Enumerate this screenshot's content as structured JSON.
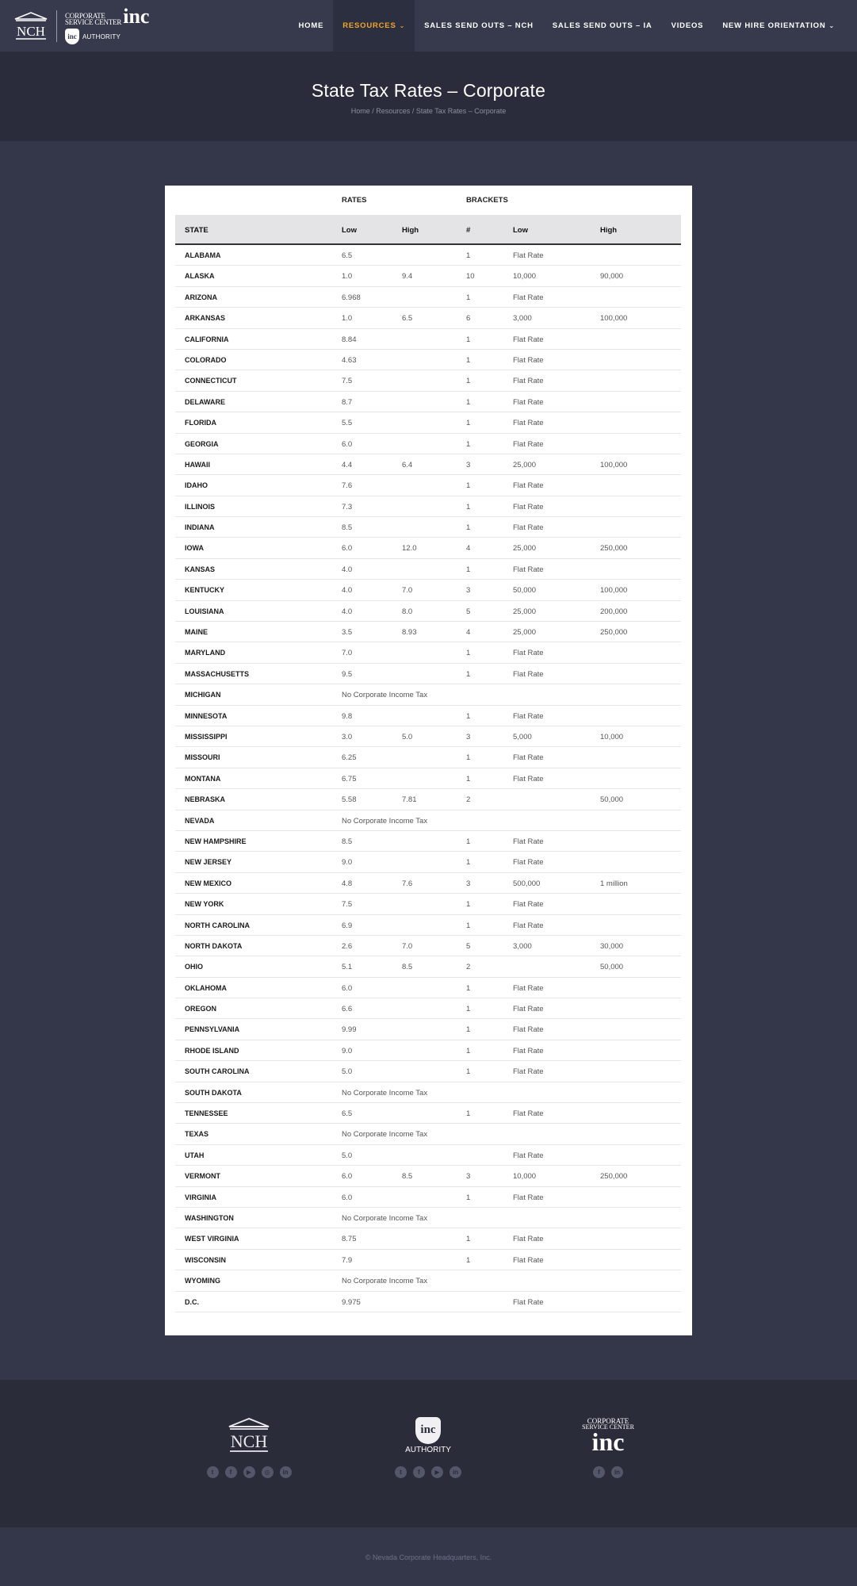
{
  "brand": {
    "nch": "NCH",
    "csc_line1": "CORPORATE",
    "csc_line2": "SERVICE CENTER",
    "csc_inc": "inc",
    "badge": "inc",
    "authority": "AUTHORITY"
  },
  "nav": [
    {
      "label": "HOME",
      "active": false,
      "dropdown": false
    },
    {
      "label": "RESOURCES",
      "active": true,
      "dropdown": true
    },
    {
      "label": "SALES SEND OUTS – NCH",
      "active": false,
      "dropdown": false
    },
    {
      "label": "SALES SEND OUTS – IA",
      "active": false,
      "dropdown": false
    },
    {
      "label": "VIDEOS",
      "active": false,
      "dropdown": false
    },
    {
      "label": "NEW HIRE ORIENTATION",
      "active": false,
      "dropdown": true
    }
  ],
  "page": {
    "title": "State Tax Rates – Corporate",
    "breadcrumb": {
      "home": "Home",
      "sep": "/",
      "resources": "Resources",
      "current": "State Tax Rates – Corporate"
    }
  },
  "table": {
    "group_headers": {
      "rates": "RATES",
      "brackets": "BRACKETS"
    },
    "columns": [
      "STATE",
      "Low",
      "High",
      "#",
      "Low",
      "High"
    ],
    "rows": [
      {
        "state": "ALABAMA",
        "low": "6.5",
        "high": "",
        "num": "1",
        "blow": "Flat Rate",
        "bhigh": ""
      },
      {
        "state": "ALASKA",
        "low": "1.0",
        "high": "9.4",
        "num": "10",
        "blow": "10,000",
        "bhigh": "90,000"
      },
      {
        "state": "ARIZONA",
        "low": "6.968",
        "high": "",
        "num": "1",
        "blow": "Flat Rate",
        "bhigh": ""
      },
      {
        "state": "ARKANSAS",
        "low": "1.0",
        "high": "6.5",
        "num": "6",
        "blow": "3,000",
        "bhigh": "100,000"
      },
      {
        "state": "CALIFORNIA",
        "low": "8.84",
        "high": "",
        "num": "1",
        "blow": "Flat Rate",
        "bhigh": ""
      },
      {
        "state": "COLORADO",
        "low": "4.63",
        "high": "",
        "num": "1",
        "blow": "Flat Rate",
        "bhigh": ""
      },
      {
        "state": "CONNECTICUT",
        "low": "7.5",
        "high": "",
        "num": "1",
        "blow": "Flat Rate",
        "bhigh": ""
      },
      {
        "state": "DELAWARE",
        "low": "8.7",
        "high": "",
        "num": "1",
        "blow": "Flat Rate",
        "bhigh": ""
      },
      {
        "state": "FLORIDA",
        "low": "5.5",
        "high": "",
        "num": "1",
        "blow": "Flat Rate",
        "bhigh": ""
      },
      {
        "state": "GEORGIA",
        "low": "6.0",
        "high": "",
        "num": "1",
        "blow": "Flat Rate",
        "bhigh": ""
      },
      {
        "state": "HAWAII",
        "low": "4.4",
        "high": "6.4",
        "num": "3",
        "blow": "25,000",
        "bhigh": "100,000"
      },
      {
        "state": "IDAHO",
        "low": "7.6",
        "high": "",
        "num": "1",
        "blow": "Flat Rate",
        "bhigh": ""
      },
      {
        "state": "ILLINOIS",
        "low": "7.3",
        "high": "",
        "num": "1",
        "blow": "Flat Rate",
        "bhigh": ""
      },
      {
        "state": "INDIANA",
        "low": "8.5",
        "high": "",
        "num": "1",
        "blow": "Flat Rate",
        "bhigh": ""
      },
      {
        "state": "IOWA",
        "low": "6.0",
        "high": "12.0",
        "num": "4",
        "blow": "25,000",
        "bhigh": "250,000"
      },
      {
        "state": "KANSAS",
        "low": "4.0",
        "high": "",
        "num": "1",
        "blow": "Flat Rate",
        "bhigh": ""
      },
      {
        "state": "KENTUCKY",
        "low": "4.0",
        "high": "7.0",
        "num": "3",
        "blow": "50,000",
        "bhigh": "100,000"
      },
      {
        "state": "LOUISIANA",
        "low": "4.0",
        "high": "8.0",
        "num": "5",
        "blow": "25,000",
        "bhigh": "200,000"
      },
      {
        "state": "MAINE",
        "low": "3.5",
        "high": "8.93",
        "num": "4",
        "blow": "25,000",
        "bhigh": "250,000"
      },
      {
        "state": "MARYLAND",
        "low": "7.0",
        "high": "",
        "num": "1",
        "blow": "Flat Rate",
        "bhigh": ""
      },
      {
        "state": "MASSACHUSETTS",
        "low": "9.5",
        "high": "",
        "num": "1",
        "blow": "Flat Rate",
        "bhigh": ""
      },
      {
        "state": "MICHIGAN",
        "low": "No Corporate Income Tax",
        "high": "",
        "num": "",
        "blow": "",
        "bhigh": ""
      },
      {
        "state": "MINNESOTA",
        "low": "9.8",
        "high": "",
        "num": "1",
        "blow": "Flat Rate",
        "bhigh": ""
      },
      {
        "state": "MISSISSIPPI",
        "low": "3.0",
        "high": "5.0",
        "num": "3",
        "blow": "5,000",
        "bhigh": "10,000"
      },
      {
        "state": "MISSOURI",
        "low": "6.25",
        "high": "",
        "num": "1",
        "blow": "Flat Rate",
        "bhigh": ""
      },
      {
        "state": "MONTANA",
        "low": "6.75",
        "high": "",
        "num": "1",
        "blow": "Flat Rate",
        "bhigh": ""
      },
      {
        "state": "NEBRASKA",
        "low": "5.58",
        "high": "7.81",
        "num": "2",
        "blow": "",
        "bhigh": "50,000"
      },
      {
        "state": "NEVADA",
        "low": "No Corporate Income Tax",
        "high": "",
        "num": "",
        "blow": "",
        "bhigh": ""
      },
      {
        "state": "NEW HAMPSHIRE",
        "low": "8.5",
        "high": "",
        "num": "1",
        "blow": "Flat Rate",
        "bhigh": ""
      },
      {
        "state": "NEW JERSEY",
        "low": "9.0",
        "high": "",
        "num": "1",
        "blow": "Flat Rate",
        "bhigh": ""
      },
      {
        "state": "NEW MEXICO",
        "low": "4.8",
        "high": "7.6",
        "num": "3",
        "blow": "500,000",
        "bhigh": "1 million"
      },
      {
        "state": "NEW YORK",
        "low": "7.5",
        "high": "",
        "num": "1",
        "blow": "Flat Rate",
        "bhigh": ""
      },
      {
        "state": "NORTH CAROLINA",
        "low": "6.9",
        "high": "",
        "num": "1",
        "blow": "Flat Rate",
        "bhigh": ""
      },
      {
        "state": "NORTH DAKOTA",
        "low": "2.6",
        "high": "7.0",
        "num": "5",
        "blow": "3,000",
        "bhigh": "30,000"
      },
      {
        "state": "OHIO",
        "low": "5.1",
        "high": "8.5",
        "num": "2",
        "blow": "",
        "bhigh": "50,000"
      },
      {
        "state": "OKLAHOMA",
        "low": "6.0",
        "high": "",
        "num": "1",
        "blow": "Flat Rate",
        "bhigh": ""
      },
      {
        "state": "OREGON",
        "low": "6.6",
        "high": "",
        "num": "1",
        "blow": "Flat Rate",
        "bhigh": ""
      },
      {
        "state": "PENNSYLVANIA",
        "low": "9.99",
        "high": "",
        "num": "1",
        "blow": "Flat Rate",
        "bhigh": ""
      },
      {
        "state": "RHODE ISLAND",
        "low": "9.0",
        "high": "",
        "num": "1",
        "blow": "Flat Rate",
        "bhigh": ""
      },
      {
        "state": "SOUTH CAROLINA",
        "low": "5.0",
        "high": "",
        "num": "1",
        "blow": "Flat Rate",
        "bhigh": ""
      },
      {
        "state": "SOUTH DAKOTA",
        "low": "No Corporate Income Tax",
        "high": "",
        "num": "",
        "blow": "",
        "bhigh": ""
      },
      {
        "state": "TENNESSEE",
        "low": "6.5",
        "high": "",
        "num": "1",
        "blow": "Flat Rate",
        "bhigh": ""
      },
      {
        "state": "TEXAS",
        "low": "No Corporate Income Tax",
        "high": "",
        "num": "",
        "blow": "",
        "bhigh": ""
      },
      {
        "state": "UTAH",
        "low": "5.0",
        "high": "",
        "num": "",
        "blow": "Flat Rate",
        "bhigh": ""
      },
      {
        "state": "VERMONT",
        "low": "6.0",
        "high": "8.5",
        "num": "3",
        "blow": "10,000",
        "bhigh": "250,000"
      },
      {
        "state": "VIRGINIA",
        "low": "6.0",
        "high": "",
        "num": "1",
        "blow": "Flat Rate",
        "bhigh": ""
      },
      {
        "state": "WASHINGTON",
        "low": "No Corporate Income Tax",
        "high": "",
        "num": "",
        "blow": "",
        "bhigh": ""
      },
      {
        "state": "WEST VIRGINIA",
        "low": "8.75",
        "high": "",
        "num": "1",
        "blow": "Flat Rate",
        "bhigh": ""
      },
      {
        "state": "WISCONSIN",
        "low": "7.9",
        "high": "",
        "num": "1",
        "blow": "Flat Rate",
        "bhigh": ""
      },
      {
        "state": "WYOMING",
        "low": "No Corporate Income Tax",
        "high": "",
        "num": "",
        "blow": "",
        "bhigh": ""
      },
      {
        "state": "D.C.",
        "low": "9.975",
        "high": "",
        "num": "",
        "blow": "Flat Rate",
        "bhigh": ""
      }
    ]
  },
  "footer": {
    "columns": [
      {
        "logo": "NCH",
        "socials": [
          "twitter-icon",
          "facebook-icon",
          "youtube-icon",
          "instagram-icon",
          "linkedin-icon"
        ]
      },
      {
        "logo": "inc",
        "logo_sub": "AUTHORITY",
        "socials": [
          "twitter-icon",
          "facebook-icon",
          "youtube-icon",
          "linkedin-icon"
        ]
      },
      {
        "logo": "inc",
        "logo_line1": "CORPORATE",
        "logo_line2": "SERVICE CENTER",
        "socials": [
          "facebook-icon",
          "linkedin-icon"
        ]
      }
    ],
    "copyright": "© Nevada Corporate Headquarters, Inc."
  },
  "colors": {
    "accent": "#f4a62a",
    "header": "#363a4c",
    "titlebar": "#2a2c3b",
    "page_bg": "#34374a"
  }
}
